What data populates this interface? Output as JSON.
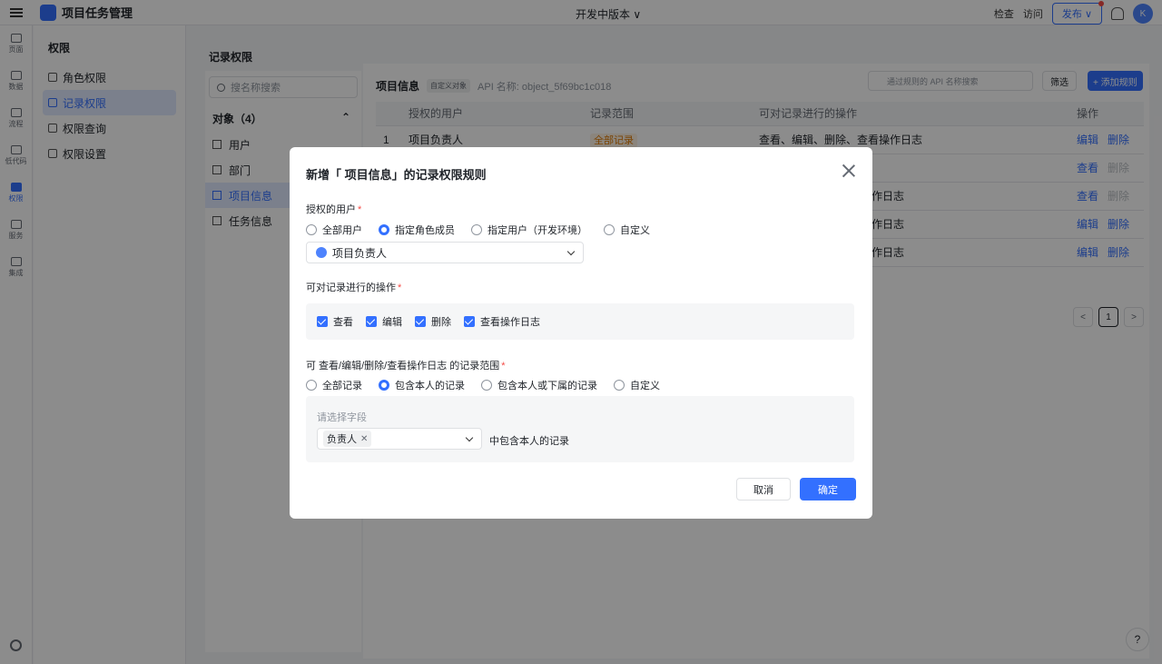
{
  "topbar": {
    "app_name": "项目任务管理",
    "env": "开发中版本 ∨",
    "check": "检查",
    "visit": "访问",
    "publish": "发布 ∨",
    "avatar_initial": "K"
  },
  "rail": [
    "页面",
    "数据",
    "流程",
    "低代码",
    "权限",
    "服务",
    "集成"
  ],
  "subnav": {
    "title": "权限",
    "items": [
      "角色权限",
      "记录权限",
      "权限查询",
      "权限设置"
    ]
  },
  "content": {
    "title": "记录权限",
    "search_placeholder": "搜名称搜索",
    "objects_head": "对象（4）",
    "objects": [
      "用户",
      "部门",
      "项目信息",
      "任务信息"
    ]
  },
  "table": {
    "object_name": "项目信息",
    "tag": "自定义对象",
    "api": "API 名称: object_5f69bc1c018",
    "search_placeholder": "通过规则的 API 名称搜索",
    "filter": "筛选",
    "add": "+ 添加规则",
    "headers": [
      "",
      "授权的用户",
      "记录范围",
      "可对记录进行的操作",
      "操作"
    ],
    "row1": {
      "idx": "1",
      "user": "项目负责人",
      "range": "全部记录",
      "ops": "查看、编辑、删除、查看操作日志"
    },
    "ops_fragment": "操作日志",
    "edit": "编辑",
    "delete": "删除",
    "view": "查看",
    "page": "1",
    "prev": "<",
    "next": ">"
  },
  "modal": {
    "title": "新增「 项目信息」的记录权限规则",
    "users_label": "授权的用户",
    "users_options": [
      "全部用户",
      "指定角色成员",
      "指定用户（开发环境）",
      "自定义"
    ],
    "selected_role": "项目负责人",
    "ops_label": "可对记录进行的操作",
    "ops": [
      "查看",
      "编辑",
      "删除",
      "查看操作日志"
    ],
    "range_label": "可 查看/编辑/删除/查看操作日志 的记录范围",
    "range_options": [
      "全部记录",
      "包含本人的记录",
      "包含本人或下属的记录",
      "自定义"
    ],
    "field_label": "请选择字段",
    "field_value": "负责人",
    "field_suffix": "中包含本人的记录",
    "cancel": "取消",
    "ok": "确定",
    "required_mark": "*"
  }
}
